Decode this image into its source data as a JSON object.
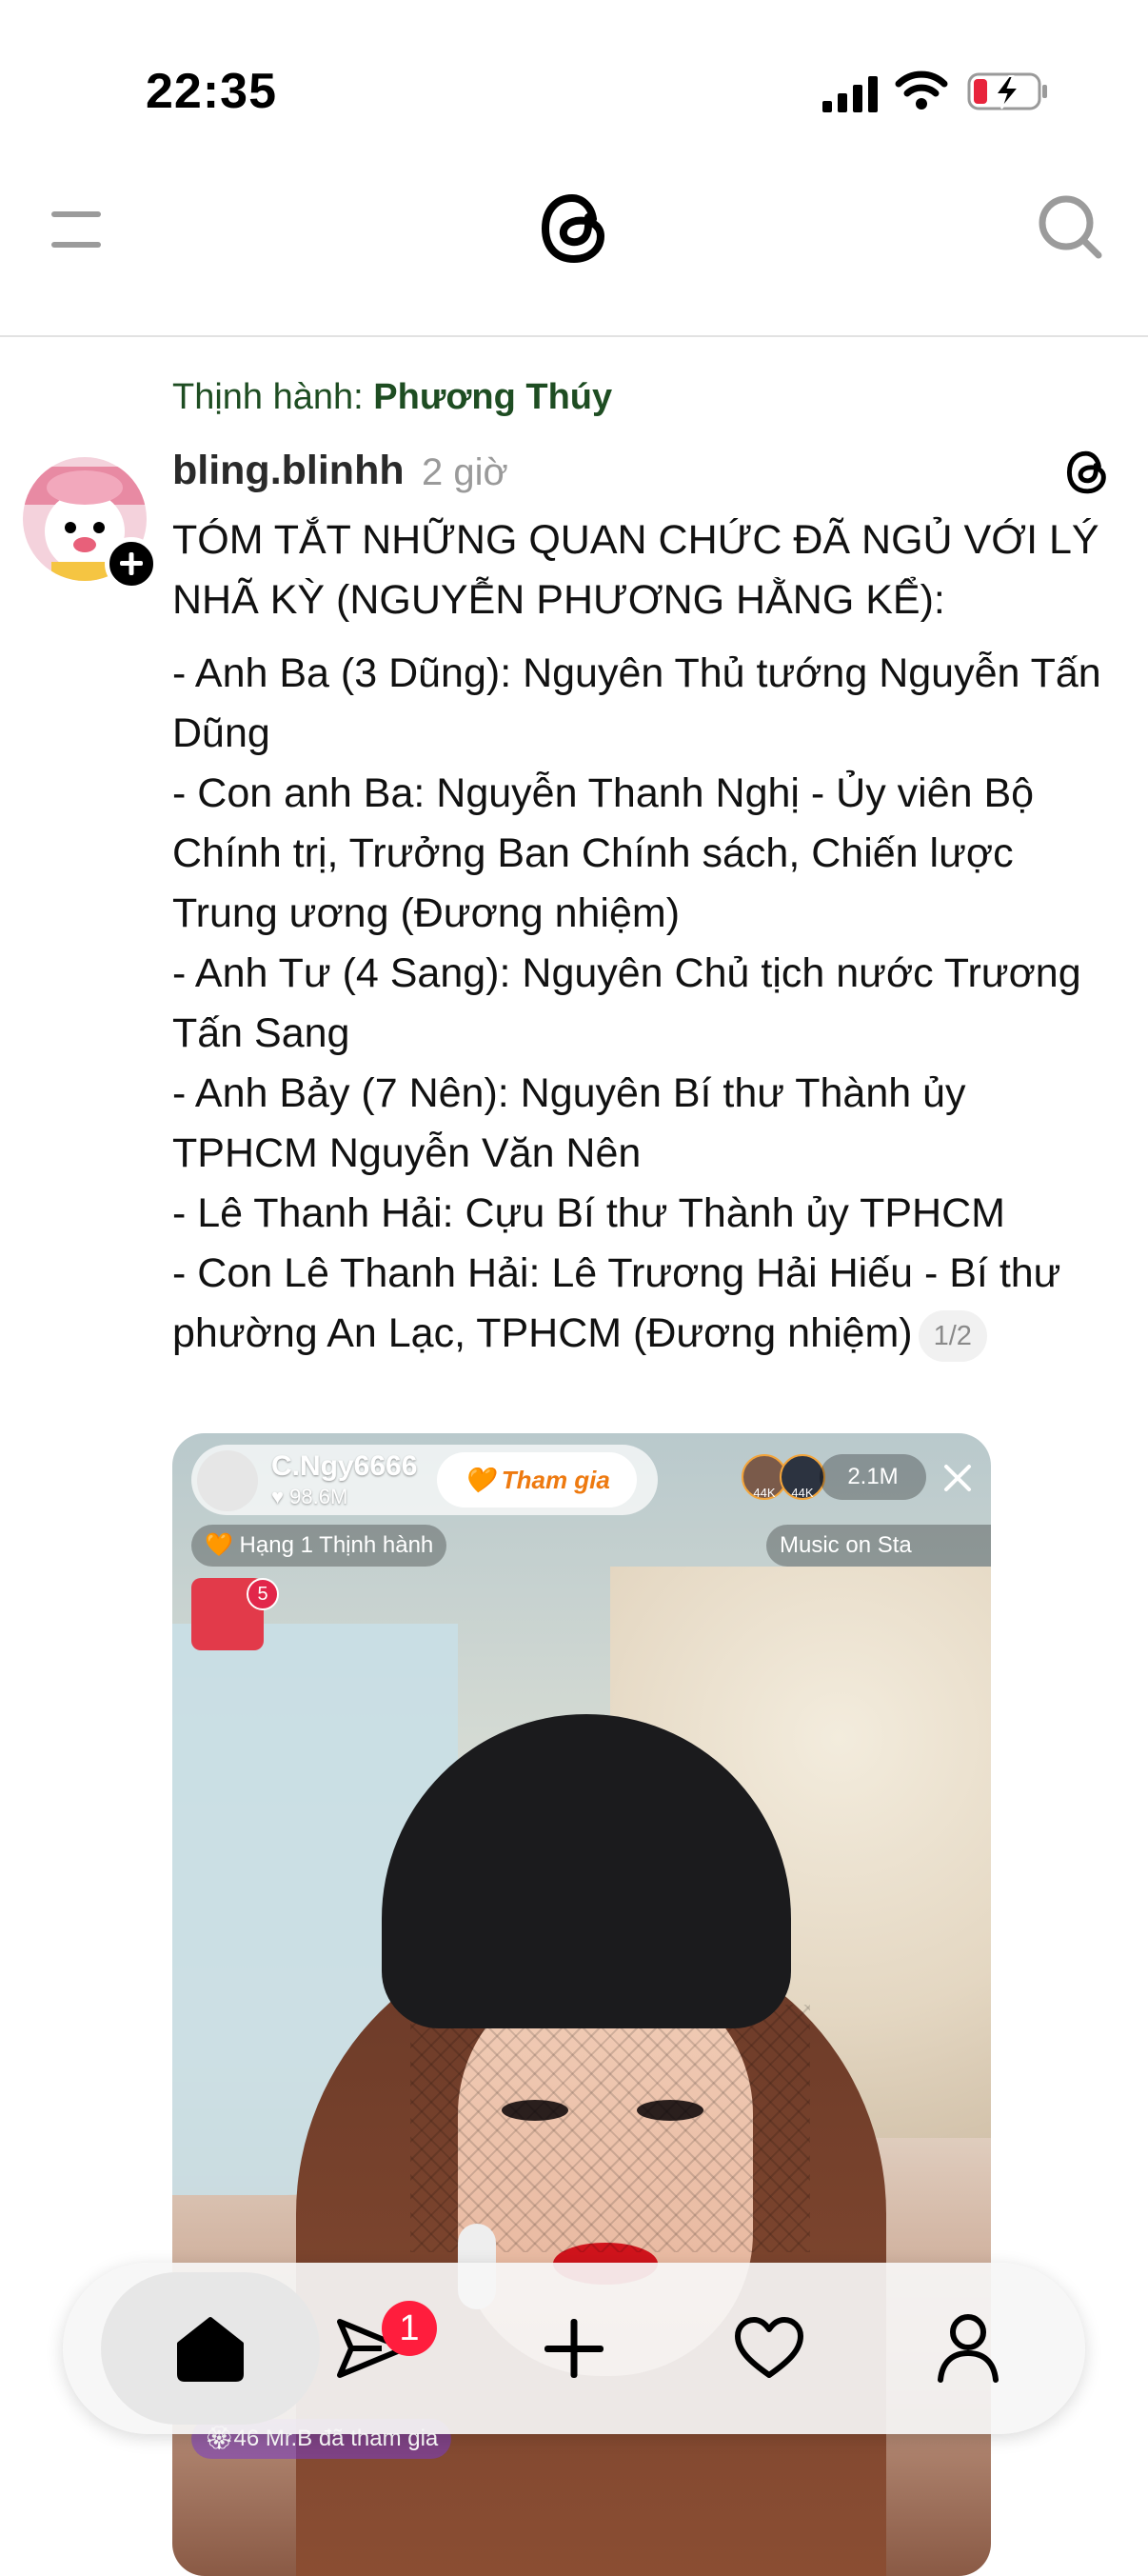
{
  "status_bar": {
    "time": "22:35"
  },
  "post": {
    "trending_label": "Thịnh hành:",
    "trending_topic": "Phương Thúy",
    "username": "bling.blinhh",
    "time_ago": "2 giờ",
    "title": "TÓM TẮT NHỮNG QUAN CHỨC ĐÃ NGỦ VỚI LÝ NHÃ KỲ (NGUYỄN PHƯƠNG HẰNG KỂ):",
    "lines": [
      "- Anh Ba (3 Dũng): Nguyên Thủ tướng Nguyễn Tấn Dũng",
      "- Con anh Ba: Nguyễn Thanh Nghị - Ủy viên Bộ Chính trị, Trưởng Ban Chính sách, Chiến lược Trung ương (Đương nhiệm)",
      "- Anh Tư (4 Sang): Nguyên Chủ tịch nước Trương Tấn Sang",
      "- Anh Bảy (7 Nên): Nguyên Bí thư Thành ủy TPHCM Nguyễn Văn Nên",
      "- Lê Thanh Hải: Cựu Bí thư Thành ủy TPHCM",
      "- Con Lê Thanh Hải: Lê Trương Hải Hiếu - Bí thư phường An Lạc, TPHCM (Đương nhiệm)"
    ],
    "page_indicator": "1/2"
  },
  "media": {
    "streamer_name": "C.Ngy6666",
    "streamer_likes": "♥ 98.6M",
    "join_label": "Tham gia",
    "viewer_count": "2.1M",
    "viewer_badge_1": "44K",
    "viewer_badge_2": "44K",
    "rank_label": "🧡 Hạng 1 Thịnh hành",
    "music_label": "Music on Sta",
    "gift_count": "5",
    "join_note": "🏵46 Mr.B đã tham gia"
  },
  "tabbar": {
    "notification_count": "1"
  },
  "colors": {
    "trend": "#1e4d22",
    "badge": "#ff1d3d",
    "join": "#ee7a10"
  }
}
